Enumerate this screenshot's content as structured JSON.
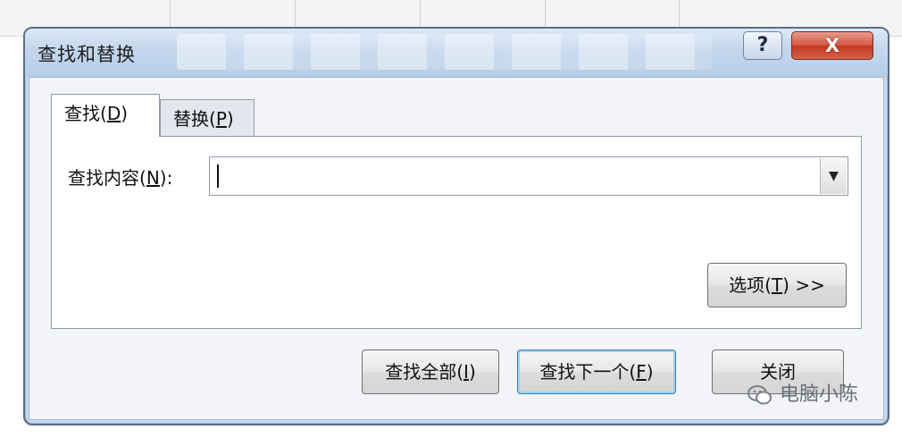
{
  "dialog": {
    "title": "查找和替换",
    "help_label": "?",
    "close_label": "X"
  },
  "tabs": [
    {
      "label": "查找(D)",
      "text": "查找(",
      "key": "D",
      "suffix": ")",
      "active": true
    },
    {
      "label": "替换(P)",
      "text": "替换(",
      "key": "P",
      "suffix": ")",
      "active": false
    }
  ],
  "find": {
    "label_text": "查找内容(",
    "label_key": "N",
    "label_suffix": "):",
    "value": ""
  },
  "buttons": {
    "options_text": "选项(",
    "options_key": "T",
    "options_suffix": ") >>",
    "find_all_text": "查找全部(",
    "find_all_key": "I",
    "find_all_suffix": ")",
    "find_next_text": "查找下一个(",
    "find_next_key": "F",
    "find_next_suffix": ")",
    "close": "关闭"
  },
  "watermark": {
    "text": "电脑小陈"
  },
  "colors": {
    "titlebar": "#c3d6ec",
    "close_button": "#c2391f",
    "default_button_border": "#3c7fb1"
  }
}
